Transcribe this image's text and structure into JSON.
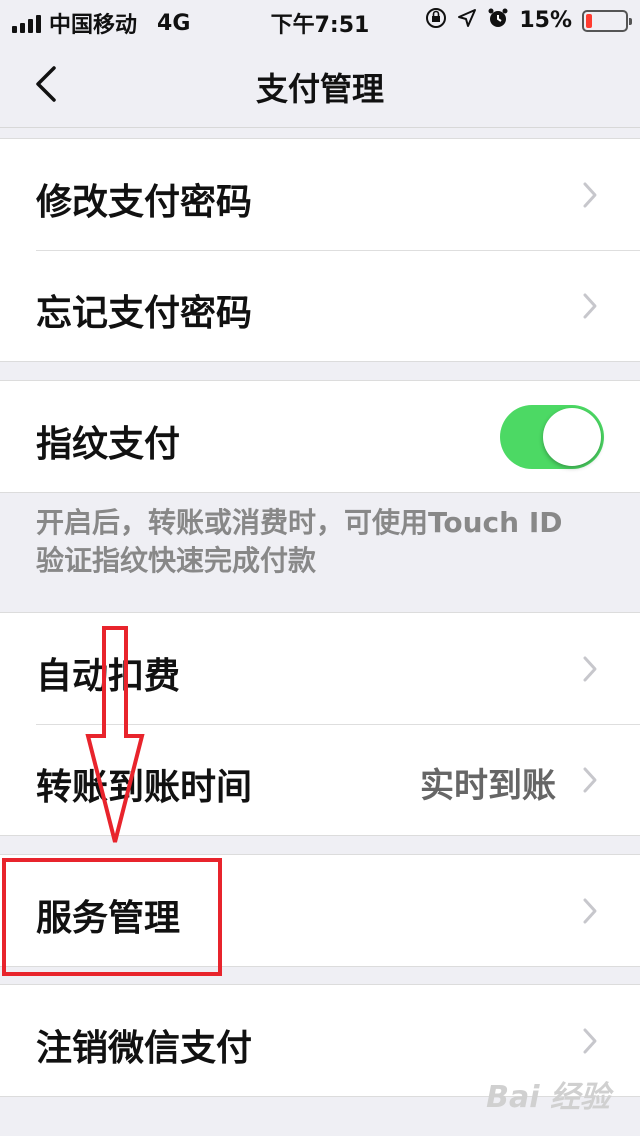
{
  "status_bar": {
    "carrier": "中国移动",
    "network": "4G",
    "time": "下午7:51",
    "battery": "15%",
    "battery_level": 0.15
  },
  "nav": {
    "title": "支付管理"
  },
  "group1": {
    "items": [
      {
        "label": "修改支付密码"
      },
      {
        "label": "忘记支付密码"
      }
    ]
  },
  "fingerprint": {
    "label": "指纹支付",
    "enabled": true,
    "hint": "开启后，转账或消费时，可使用Touch ID 验证指纹快速完成付款"
  },
  "group3": {
    "items": [
      {
        "label": "自动扣费"
      },
      {
        "label": "转账到账时间",
        "value": "实时到账"
      }
    ]
  },
  "group4": {
    "items": [
      {
        "label": "服务管理"
      }
    ]
  },
  "group5": {
    "items": [
      {
        "label": "注销微信支付"
      }
    ]
  },
  "colors": {
    "toggle_on": "#4cd964",
    "annotation": "#e8242c",
    "background": "#efeff4"
  },
  "watermark": "Bai 经验"
}
